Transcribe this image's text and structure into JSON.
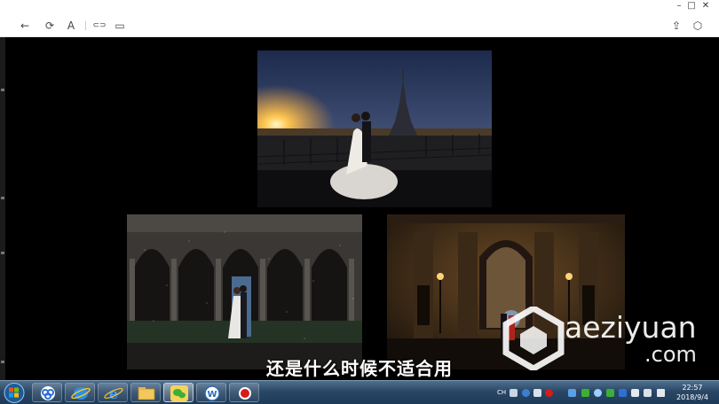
{
  "window": {
    "controls": {
      "minimize": "–",
      "maximize": "□",
      "close": "✕"
    }
  },
  "toolbar": {
    "items": [
      {
        "icon": "back-arrow-icon",
        "glyph": "←"
      },
      {
        "icon": "rotate-icon",
        "glyph": "⟳"
      },
      {
        "icon": "text-icon",
        "glyph": "A"
      },
      {
        "icon": "link-icon",
        "glyph": "⊂⊃"
      },
      {
        "icon": "window-icon",
        "glyph": "▭"
      }
    ],
    "right_items": [
      {
        "icon": "share-icon",
        "glyph": "⇪"
      },
      {
        "icon": "cube-icon",
        "glyph": "⬡"
      }
    ]
  },
  "left_ruler": {
    "ticks": [
      "",
      "",
      "",
      ""
    ]
  },
  "content": {
    "photos": [
      {
        "name": "eiffel-tower-sunset-photo",
        "scene": "couple-on-rooftop-at-sunset-with-eiffel-tower"
      },
      {
        "name": "cloister-rain-photo",
        "scene": "couple-in-gothic-arcade-at-night"
      },
      {
        "name": "night-building-photo",
        "scene": "couple-before-lit-stone-facade-at-night"
      }
    ],
    "subtitle": "还是什么时候不适合用"
  },
  "watermark": {
    "brand": "aeziyuan",
    "tld": ".com"
  },
  "taskbar": {
    "start_icon": "windows-start-icon",
    "apps": [
      {
        "icon": "baidu-netdisk-icon"
      },
      {
        "icon": "ie-blue-icon"
      },
      {
        "icon": "internet-explorer-icon"
      },
      {
        "icon": "file-explorer-icon"
      },
      {
        "icon": "wechat-icon"
      },
      {
        "icon": "app-w-icon"
      },
      {
        "icon": "record-icon"
      }
    ],
    "tray": {
      "ime": "CH",
      "clock_time": "22:57",
      "clock_date": "2018/9/4"
    }
  },
  "colors": {
    "taskbar": "#2a4766",
    "toolbar_bg": "#ffffff",
    "canvas_bg": "#000000",
    "record_red": "#d71a1a"
  }
}
